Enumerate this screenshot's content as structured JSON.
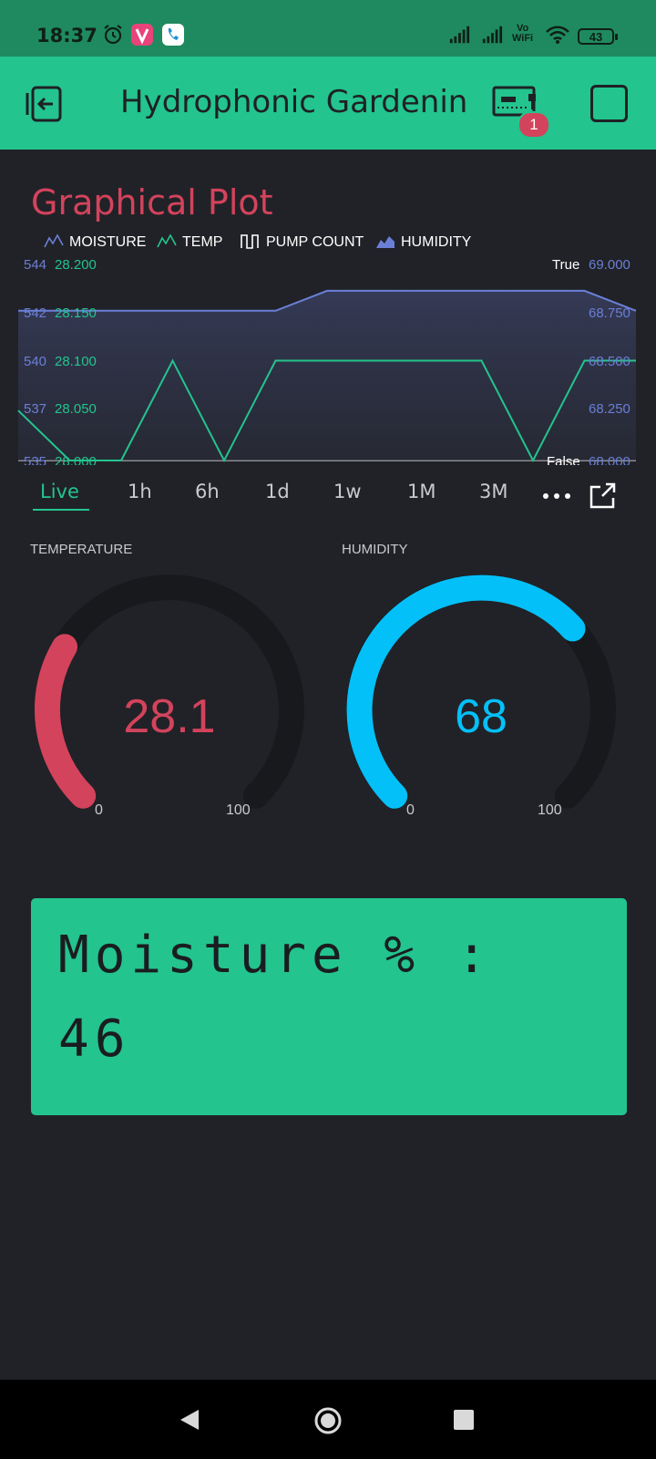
{
  "status_bar": {
    "time": "18:37",
    "vowifi_top": "Vo",
    "vowifi_bottom": "WiFi",
    "battery": "43"
  },
  "app_bar": {
    "title": "Hydrophonic Gardenin",
    "device_badge": "1"
  },
  "plot": {
    "title": "Graphical Plot",
    "legend": [
      {
        "label": "MOISTURE",
        "icon": "line-chart-icon",
        "color": "#6b7fd7"
      },
      {
        "label": "TEMP",
        "icon": "line-chart-icon",
        "color": "#23c48e"
      },
      {
        "label": "PUMP COUNT",
        "icon": "step-chart-icon",
        "color": "#ffffff"
      },
      {
        "label": "HUMIDITY",
        "icon": "area-chart-icon",
        "color": "#6b7fd7"
      }
    ],
    "left_axis_moisture": [
      "544",
      "542",
      "540",
      "537",
      "535"
    ],
    "left_axis_temp": [
      "28.200",
      "28.150",
      "28.100",
      "28.050",
      "28.000"
    ],
    "right_axis_pump": [
      "True",
      "False"
    ],
    "right_axis_humidity": [
      "69.000",
      "68.750",
      "68.500",
      "68.250",
      "68.000"
    ],
    "ranges": [
      "Live",
      "1h",
      "6h",
      "1d",
      "1w",
      "1M",
      "3M"
    ],
    "active_range": "Live"
  },
  "chart_data": {
    "type": "line",
    "series": [
      {
        "name": "TEMP",
        "color": "#23c48e",
        "values": [
          28.05,
          28.0,
          28.0,
          28.1,
          28.0,
          28.1,
          28.1,
          28.1,
          28.1,
          28.1,
          28.0,
          28.1,
          28.1
        ]
      },
      {
        "name": "HUMIDITY",
        "color": "#6b7fd7",
        "values": [
          68.75,
          68.75,
          68.75,
          68.75,
          68.75,
          68.75,
          68.85,
          68.85,
          68.85,
          68.85,
          68.85,
          68.85,
          68.75
        ]
      }
    ],
    "x_points": 13,
    "ylim_temp": [
      28.0,
      28.2
    ],
    "ylim_humidity": [
      68.0,
      69.0
    ]
  },
  "gauges": [
    {
      "title": "TEMPERATURE",
      "value": "28.1",
      "numeric": 28.1,
      "min": "0",
      "max": "100",
      "color": "#d3435c"
    },
    {
      "title": "HUMIDITY",
      "value": "68",
      "numeric": 68,
      "min": "0",
      "max": "100",
      "color": "#04c0f8"
    }
  ],
  "lcd": {
    "line1": "Moisture % :",
    "line2": "46"
  },
  "colors": {
    "accent": "#23c48e",
    "background": "#212227",
    "status_bar": "#1f8a60",
    "red": "#d3435c",
    "blue": "#04c0f8",
    "moisture": "#6b7fd7"
  }
}
